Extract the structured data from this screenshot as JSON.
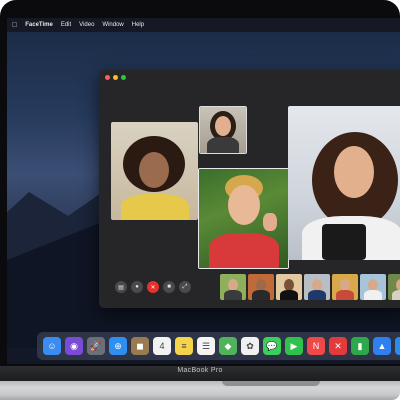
{
  "menubar": {
    "apple_icon": "apple-icon",
    "app_name": "FaceTime",
    "items": [
      "Edit",
      "Video",
      "Window",
      "Help"
    ]
  },
  "facetime": {
    "controls": [
      {
        "name": "sidebar-toggle",
        "glyph": "▤"
      },
      {
        "name": "mute",
        "glyph": "●"
      },
      {
        "name": "end-call",
        "glyph": "✕"
      },
      {
        "name": "camera-toggle",
        "glyph": "■"
      },
      {
        "name": "fullscreen",
        "glyph": "⤢"
      }
    ],
    "thumbnail_count": 7
  },
  "dock": {
    "icons": [
      {
        "name": "finder-icon",
        "color": "#3b8cf0",
        "glyph": "☺"
      },
      {
        "name": "siri-icon",
        "color": "#7a4bd6",
        "glyph": "◉"
      },
      {
        "name": "launchpad-icon",
        "color": "#6a6f7a",
        "glyph": "🚀"
      },
      {
        "name": "safari-icon",
        "color": "#2f8ff0",
        "glyph": "⊕"
      },
      {
        "name": "contacts-icon",
        "color": "#9a7b50",
        "glyph": "◼"
      },
      {
        "name": "calendar-icon",
        "color": "#f2f2f2",
        "glyph": "4"
      },
      {
        "name": "notes-icon",
        "color": "#f5d44c",
        "glyph": "≡"
      },
      {
        "name": "reminders-icon",
        "color": "#f4f4f4",
        "glyph": "☰"
      },
      {
        "name": "maps-icon",
        "color": "#4fb35a",
        "glyph": "◆"
      },
      {
        "name": "photos-icon",
        "color": "#f0f0f0",
        "glyph": "✿"
      },
      {
        "name": "messages-icon",
        "color": "#3ccf5a",
        "glyph": "💬"
      },
      {
        "name": "facetime-icon",
        "color": "#2fc34d",
        "glyph": "▶"
      },
      {
        "name": "news-icon",
        "color": "#f04848",
        "glyph": "N"
      },
      {
        "name": "stocks-icon",
        "color": "#e33b3b",
        "glyph": "✕"
      },
      {
        "name": "numbers-icon",
        "color": "#2ea84a",
        "glyph": "▮"
      },
      {
        "name": "keynote-icon",
        "color": "#2e7ff0",
        "glyph": "▲"
      },
      {
        "name": "appstore-icon",
        "color": "#2b8cf0",
        "glyph": "A"
      },
      {
        "name": "itunes-icon",
        "color": "#ef3e5c",
        "glyph": "♫"
      }
    ]
  },
  "laptop": {
    "model": "MacBook Pro"
  }
}
